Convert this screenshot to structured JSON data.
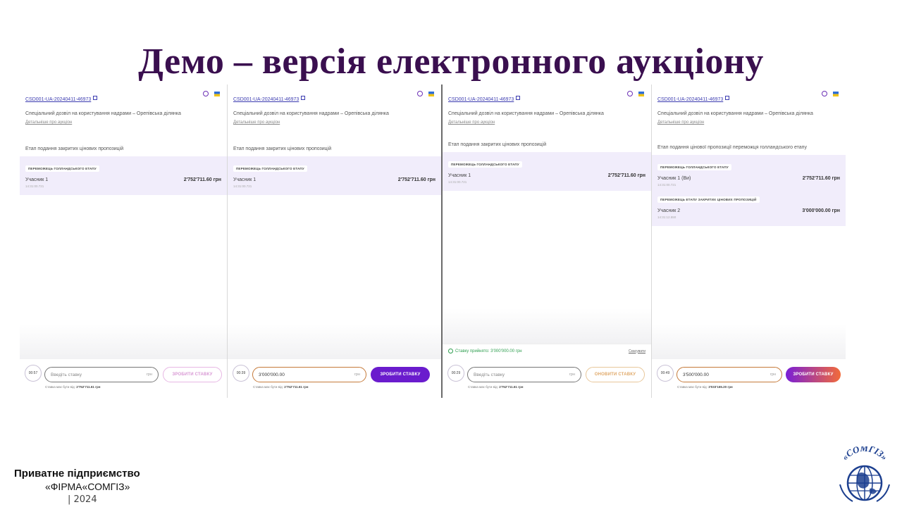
{
  "slide": {
    "title": "Демо – версія  електронного аукціону",
    "org_line1": "Приватне підприємство",
    "org_line2": "«ФІРМА«СОМГІЗ»",
    "year": "| 2024",
    "logo_text": "«СОМГІЗ»"
  },
  "panels": [
    {
      "auction_id": "CSD001-UA-20240411-46973",
      "lot_name": "Спеціальний дозвіл на користування надрами – Орепівська ділянка",
      "details_link": "Детальніше про аукціон",
      "stage": "Етап подання закритих цінових пропозицій",
      "badge1": "ПЕРЕМОЖЕЦЬ ГОЛЛАНДСЬКОГО ЕТАПУ",
      "p1_name": "Учасник 1",
      "p1_amount": "2'752'711.60 грн",
      "p1_time": "14:31:00.721",
      "timer": "00:57",
      "bid_placeholder": "Введіть ставку",
      "currency": "грн",
      "button": "ЗРОБИТИ СТАВКУ",
      "min_label": "Ставка має бути від:",
      "min_value": "2'752'711.61 грн"
    },
    {
      "auction_id": "CSD001-UA-20240411-46973",
      "lot_name": "Спеціальний дозвіл на користування надрами – Орепівська ділянка",
      "details_link": "Детальніше про аукціон",
      "stage": "Етап подання закритих цінових пропозицій",
      "badge1": "ПЕРЕМОЖЕЦЬ ГОЛЛАНДСЬКОГО ЕТАПУ",
      "p1_name": "Учасник 1",
      "p1_amount": "2'752'711.60 грн",
      "p1_time": "14:31:00.721",
      "timer": "00:39",
      "bid_value": "3'000'000.00",
      "currency": "грн",
      "button": "ЗРОБИТИ СТАВКУ",
      "min_label": "Ставка має бути від:",
      "min_value": "2'752'711.61 грн"
    },
    {
      "auction_id": "CSD001-UA-20240411-46973",
      "lot_name": "Спеціальний дозвіл на користування надрами – Орепівська ділянка",
      "details_link": "Детальніше про аукціон",
      "stage": "Етап подання закритих цінових пропозицій",
      "badge1": "ПЕРЕМОЖЕЦЬ ГОЛЛАНДСЬКОГО ЕТАПУ",
      "p1_name": "Учасник 1",
      "p1_amount": "2'752'711.60 грн",
      "p1_time": "14:31:00.721",
      "accepted": "Ставку прийнято: 3'000'000.00 грн",
      "cancel": "Скасувати",
      "timer": "00:29",
      "bid_placeholder": "Введіть ставку",
      "currency": "грн",
      "button": "ОНОВИТИ СТАВКУ",
      "min_label": "Ставка має бути від:",
      "min_value": "2'752'711.61 грн"
    },
    {
      "auction_id": "CSD001-UA-20240411-46973",
      "lot_name": "Спеціальний дозвіл на користування надрами – Орепівська ділянка",
      "details_link": "Детальніше про аукціон",
      "stage": "Етап подання цінової пропозиції переможця голландського етапу",
      "badge1": "ПЕРЕМОЖЕЦЬ ГОЛЛАНДСЬКОГО ЕТАПУ",
      "p1_name": "Учасник 1 (Ви)",
      "p1_amount": "2'752'711.60 грн",
      "p1_time": "14:31:00.721",
      "badge2": "ПЕРЕМОЖЕЦЬ ЕТАПУ ЗАКРИТИХ ЦІНОВИХ ПРОПОЗИЦІЙ",
      "p2_name": "Учасник 2",
      "p2_amount": "3'000'000.00 грн",
      "p2_time": "14:31:12.550",
      "timer": "00:49",
      "bid_value": "3'500'000.00",
      "currency": "грн",
      "button": "ЗРОБИТИ СТАВКУ",
      "min_label": "Ставка має бути від:",
      "min_value": "3'033'165.20 грн"
    }
  ],
  "colors": {
    "title": "#3a0f4f",
    "accent_purple": "#6a1ccd",
    "winner_bg": "#f1edfb",
    "success": "#2e9e4f"
  }
}
